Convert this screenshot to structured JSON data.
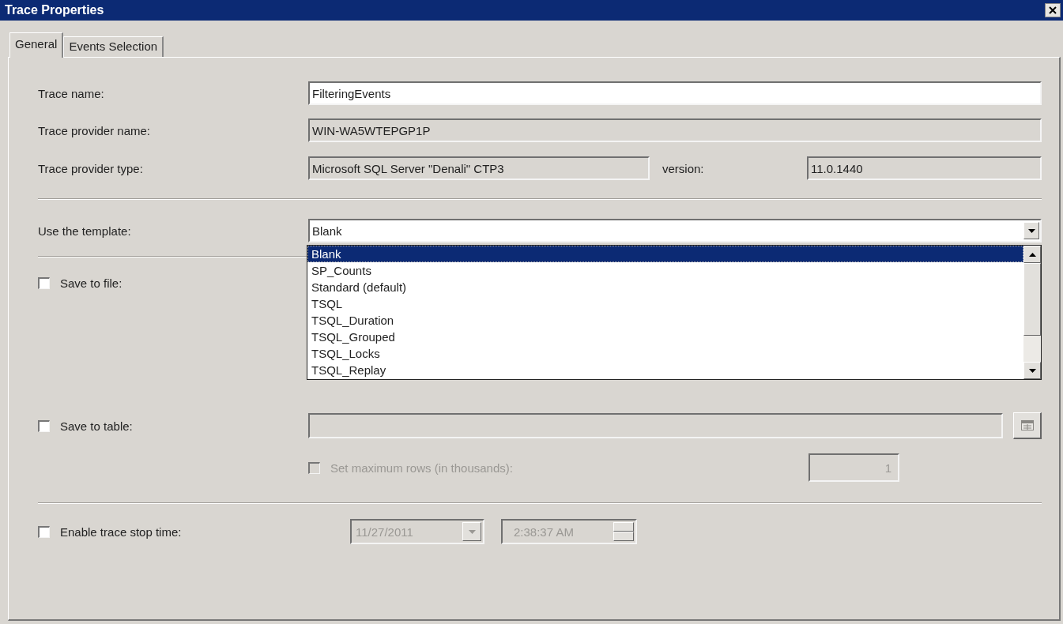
{
  "window": {
    "title": "Trace Properties"
  },
  "tabs": [
    {
      "label": "General",
      "selected": true
    },
    {
      "label": "Events Selection",
      "selected": false
    }
  ],
  "trace_name": {
    "label": "Trace name:",
    "value": "FilteringEvents"
  },
  "provider_name": {
    "label": "Trace provider name:",
    "value": "WIN-WA5WTEPGP1P"
  },
  "provider_type": {
    "label": "Trace provider type:",
    "value": "Microsoft SQL Server \"Denali\" CTP3",
    "version_label": "version:",
    "version": "11.0.1440"
  },
  "template": {
    "label": "Use the template:",
    "value": "Blank",
    "expanded": true,
    "options": [
      {
        "label": "Blank",
        "selected": true
      },
      {
        "label": "SP_Counts",
        "selected": false
      },
      {
        "label": "Standard (default)",
        "selected": false
      },
      {
        "label": "TSQL",
        "selected": false
      },
      {
        "label": "TSQL_Duration",
        "selected": false
      },
      {
        "label": "TSQL_Grouped",
        "selected": false
      },
      {
        "label": "TSQL_Locks",
        "selected": false
      },
      {
        "label": "TSQL_Replay",
        "selected": false
      }
    ]
  },
  "save_to_file": {
    "label": "Save to file:",
    "checked": false
  },
  "save_to_table": {
    "label": "Save to table:",
    "checked": false
  },
  "max_rows": {
    "label": "Set maximum rows (in thousands):",
    "checked": false,
    "disabled": true,
    "value": "1"
  },
  "stop_time": {
    "label": "Enable trace stop time:",
    "checked": false,
    "date": "11/27/2011",
    "time": "2:38:37 AM"
  }
}
